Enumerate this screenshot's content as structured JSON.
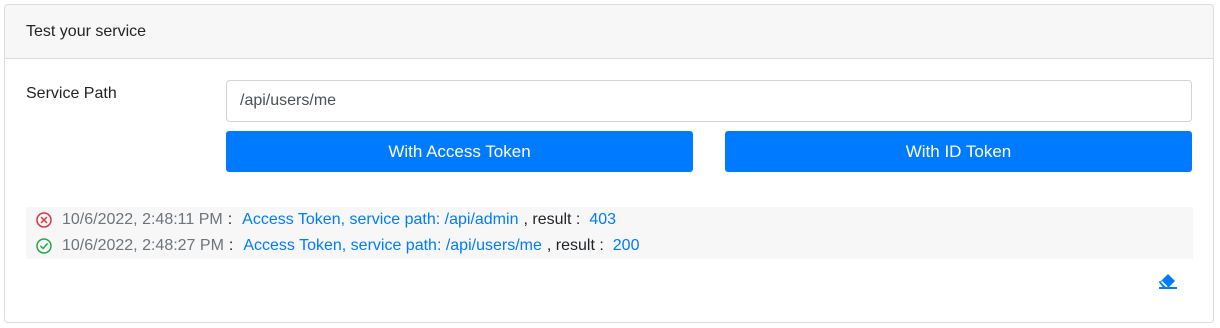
{
  "header": {
    "title": "Test your service"
  },
  "form": {
    "path_label": "Service Path",
    "path_value": "/api/users/me"
  },
  "buttons": {
    "access_token": "With Access Token",
    "id_token": "With ID Token"
  },
  "log": [
    {
      "status": "error",
      "status_icon": "x-circle-icon",
      "timestamp": "10/6/2022, 2:48:11 PM",
      "separator": ":",
      "description": "Access Token, service path: /api/admin",
      "result_label": ", result :",
      "result": "403"
    },
    {
      "status": "success",
      "status_icon": "check-circle-icon",
      "timestamp": "10/6/2022, 2:48:27 PM",
      "separator": ":",
      "description": "Access Token, service path: /api/users/me",
      "result_label": ", result :",
      "result": "200"
    }
  ],
  "clear_icon": "eraser-icon",
  "colors": {
    "primary": "#007bff",
    "error": "#dc3545",
    "success": "#28a745",
    "header_bg": "#f7f7f7"
  }
}
